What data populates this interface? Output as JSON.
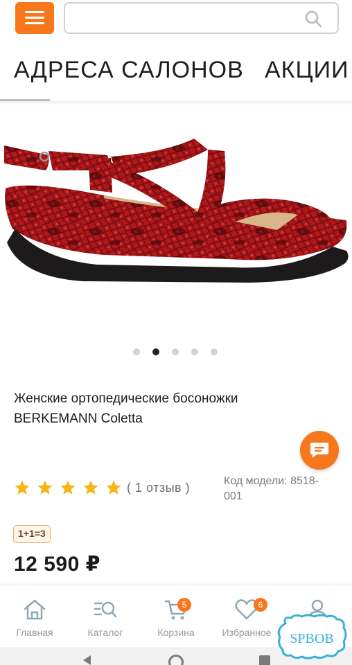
{
  "header": {
    "menu_icon": "hamburger-menu-icon",
    "search_placeholder": "",
    "search_icon": "search-icon",
    "accent_color": "#f7781c"
  },
  "nav": {
    "items": [
      {
        "label": "АДРЕСА САЛОНОВ"
      },
      {
        "label": "АКЦИИ"
      }
    ]
  },
  "product": {
    "image_icon": "sandal-product-image",
    "carousel": {
      "total": 5,
      "active": 2
    },
    "title": "Женские ортопедические босоножки BERKEMANN Coletta",
    "rating": {
      "stars": 5,
      "max": 5,
      "reviews_label": "( 1 отзыв )"
    },
    "model_label": "Код модели: 8518-001",
    "promo_badge": "1+1=3",
    "price": "12 590 ₽"
  },
  "chat": {
    "icon": "chat-bubble-icon"
  },
  "bottom_nav": {
    "items": [
      {
        "label": "Главная",
        "icon": "home-icon"
      },
      {
        "label": "Каталог",
        "icon": "catalog-search-icon"
      },
      {
        "label": "Корзина",
        "icon": "cart-icon",
        "badge": "5"
      },
      {
        "label": "Избранное",
        "icon": "heart-icon",
        "badge": "6"
      },
      {
        "label": "",
        "icon": "profile-icon"
      }
    ]
  },
  "watermark": {
    "text": "SPBOB"
  }
}
